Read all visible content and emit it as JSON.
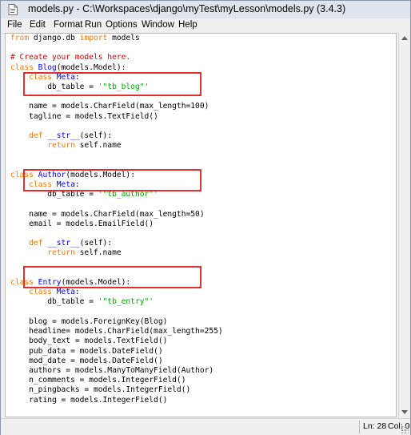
{
  "window": {
    "title": "models.py - C:\\Workspaces\\django\\myTest\\myLesson\\models.py (3.4.3)",
    "icon": "python-file-icon"
  },
  "menu": [
    "File",
    "Edit",
    "Format",
    "Run",
    "Options",
    "Window",
    "Help"
  ],
  "code": {
    "lines": [
      "from django.db import models",
      "",
      "# Create your models here.",
      "class Blog(models.Model):",
      "    class Meta:",
      "        db_table = '\"tb_blog\"'",
      "",
      "    name = models.CharField(max_length=100)",
      "    tagline = models.TextField()",
      "",
      "    def __str__(self):",
      "        return self.name",
      "",
      "",
      "class Author(models.Model):",
      "    class Meta:",
      "        db_table = '\"tb_author\"'",
      "",
      "    name = models.CharField(max_length=50)",
      "    email = models.EmailField()",
      "",
      "    def __str__(self):",
      "        return self.name",
      "",
      "",
      "class Entry(models.Model):",
      "    class Meta:",
      "        db_table = '\"tb_entry\"'",
      "",
      "    blog = models.ForeignKey(Blog)",
      "    headline= models.CharField(max_length=255)",
      "    body_text = models.TextField()",
      "    pub_data = models.DateField()",
      "    mod_date = models.DateField()",
      "    authors = models.ManyToManyField(Author)",
      "    n_comments = models.IntegerField()",
      "    n_pingbacks = models.IntegerField()",
      "    rating = models.IntegerField()"
    ]
  },
  "status": {
    "line": "Ln: 28",
    "col": "Col: 0"
  },
  "colors": {
    "keyword": "#ff7700",
    "definition": "#0000ff",
    "string": "#00aa00",
    "comment": "#dd0000",
    "highlight_box": "#e03030"
  }
}
